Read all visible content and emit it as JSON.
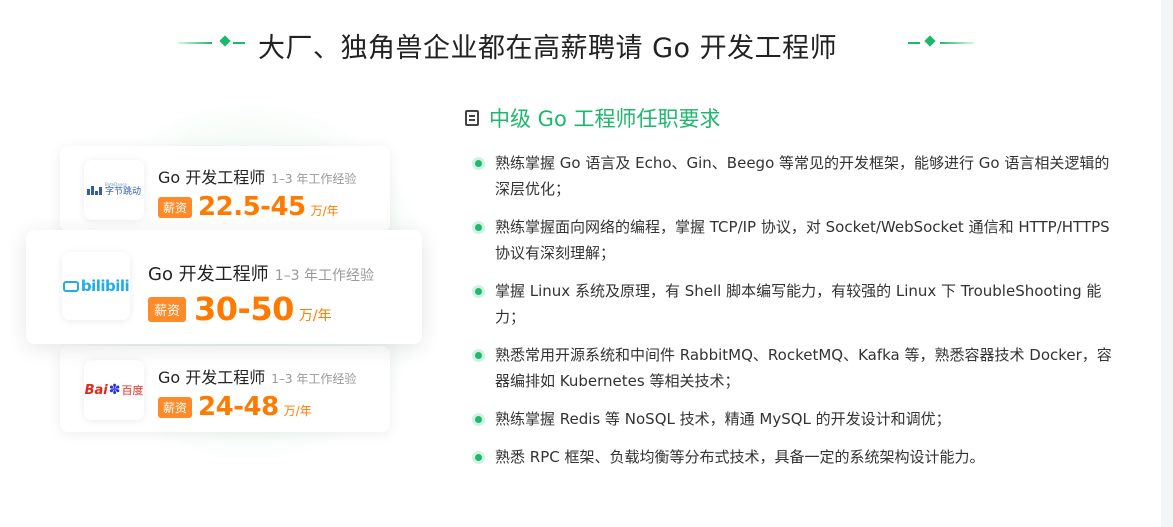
{
  "title": "大厂、独角兽企业都在高薪聘请 Go 开发工程师",
  "jobs": [
    {
      "company": "bytedance",
      "logo_text": "字节跳动",
      "logo_small": "ByteDance",
      "title": "Go 开发工程师",
      "experience": "1–3 年工作经验",
      "salary_badge": "薪资",
      "salary_range": "22.5-45",
      "salary_unit": "万/年"
    },
    {
      "company": "bilibili",
      "logo_text": "bilibili",
      "title": "Go 开发工程师",
      "experience": "1–3 年工作经验",
      "salary_badge": "薪资",
      "salary_range": "30-50",
      "salary_unit": "万/年"
    },
    {
      "company": "baidu",
      "logo_text_bai": "Bai",
      "logo_text_du": "百度",
      "title": "Go 开发工程师",
      "experience": "1–3 年工作经验",
      "salary_badge": "薪资",
      "salary_range": "24-48",
      "salary_unit": "万/年"
    }
  ],
  "requirements": {
    "heading": "中级 Go 工程师任职要求",
    "items": [
      "熟练掌握 Go 语言及 Echo、Gin、Beego 等常见的开发框架，能够进行 Go 语言相关逻辑的深层优化；",
      "熟练掌握面向网络的编程，掌握 TCP/IP 协议，对 Socket/WebSocket 通信和 HTTP/HTTPS 协议有深刻理解；",
      "掌握 Linux 系统及原理，有 Shell 脚本编写能力，有较强的 Linux 下 TroubleShooting 能力；",
      "熟悉常用开源系统和中间件 RabbitMQ、RocketMQ、Kafka 等，熟悉容器技术 Docker，容器编排如 Kubernetes 等相关技术；",
      "熟练掌握 Redis 等 NoSQL 技术，精通 MySQL 的开发设计和调优；",
      "熟悉 RPC 框架、负载均衡等分布式技术，具备一定的系统架构设计能力。"
    ]
  },
  "colors": {
    "accent_green": "#1cb86b",
    "salary_orange": "#ff7a00",
    "badge_orange": "#ff8a2a"
  }
}
